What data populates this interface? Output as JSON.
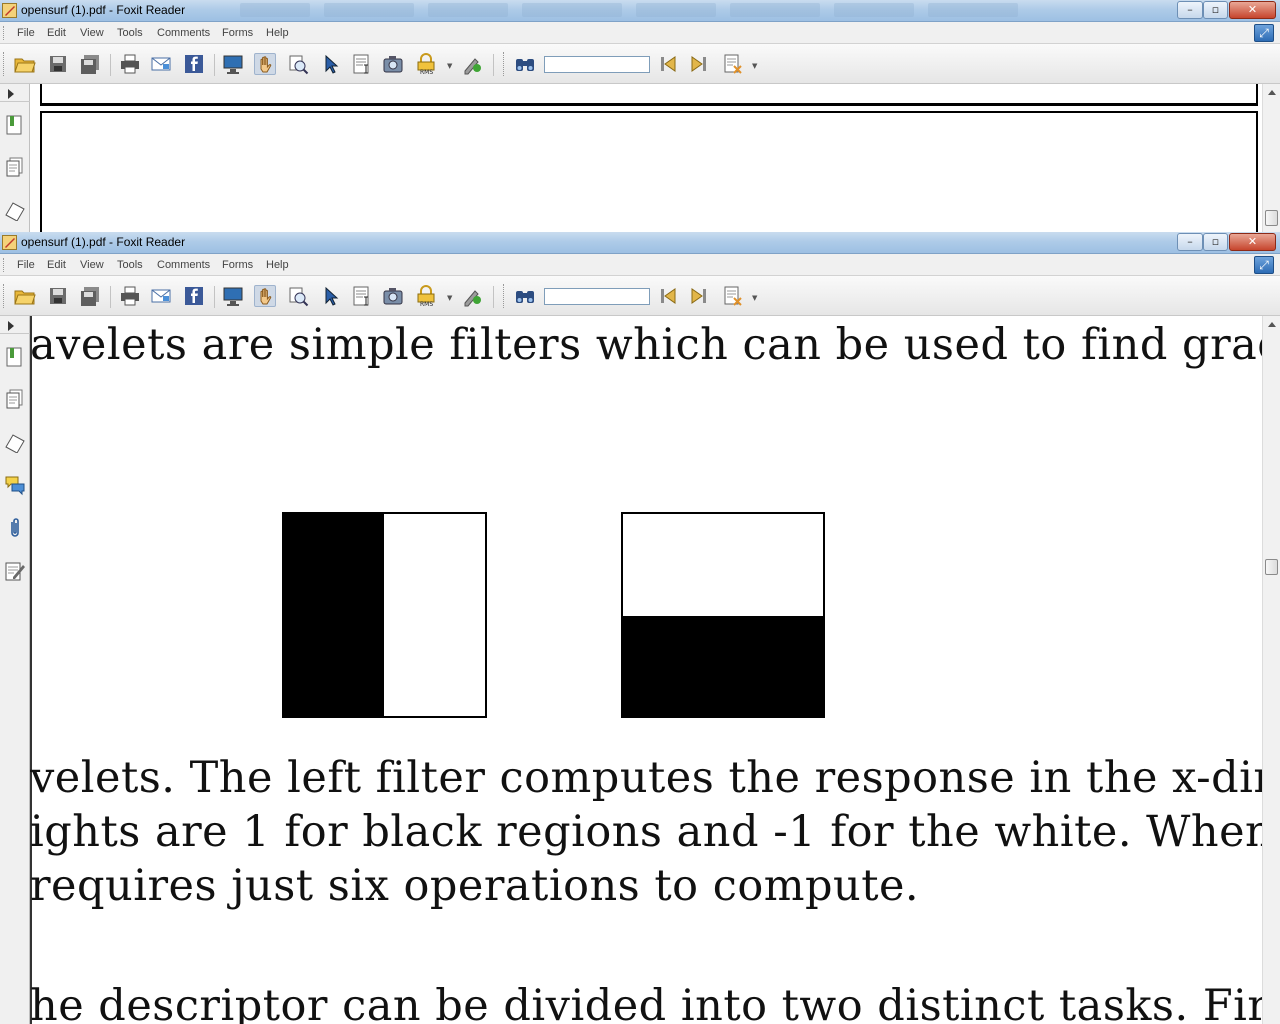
{
  "windows": [
    {
      "title": "opensurf (1).pdf - Foxit Reader",
      "menu": [
        "File",
        "Edit",
        "View",
        "Tools",
        "Comments",
        "Forms",
        "Help"
      ],
      "search": {
        "value": "",
        "placeholder": ""
      }
    },
    {
      "title": "opensurf (1).pdf - Foxit Reader",
      "menu": [
        "File",
        "Edit",
        "View",
        "Tools",
        "Comments",
        "Forms",
        "Help"
      ],
      "search": {
        "value": "",
        "placeholder": ""
      },
      "document": {
        "lines": [
          "avelets are simple filters which can be used to find gradients",
          "velets. The left filter computes the response in the x-direction and",
          "ights are 1 for black regions and -1 for the white. When used wit",
          " requires just six operations to compute.",
          "he descriptor can be divided into two distinct tasks. First"
        ],
        "figure": {
          "left_filter": "x-direction Haar wavelet (black left, white right)",
          "right_filter": "y-direction Haar wavelet (white top, black bottom)"
        }
      }
    }
  ],
  "window_controls": {
    "minimize": "–",
    "maximize": "▫",
    "close": "✕"
  },
  "icons": {
    "toolbar": [
      "open-folder-icon",
      "save-icon",
      "save-as-icon",
      "print-icon",
      "email-icon",
      "facebook-icon",
      "fullscreen-icon",
      "hand-tool-icon",
      "zoom-icon",
      "select-arrow-icon",
      "text-select-icon",
      "snapshot-icon",
      "rms-lock-icon",
      "sign-icon",
      "find-binoculars-icon",
      "find-prev-icon",
      "find-next-icon",
      "search-results-icon"
    ],
    "sidebar": [
      "bookmarks-icon",
      "pages-icon",
      "layers-icon",
      "comments-icon",
      "attachments-icon",
      "signatures-icon"
    ]
  },
  "colors": {
    "accent": "#2d6cb5",
    "title_gradient": "#aecbe8",
    "close": "#c6452d"
  }
}
